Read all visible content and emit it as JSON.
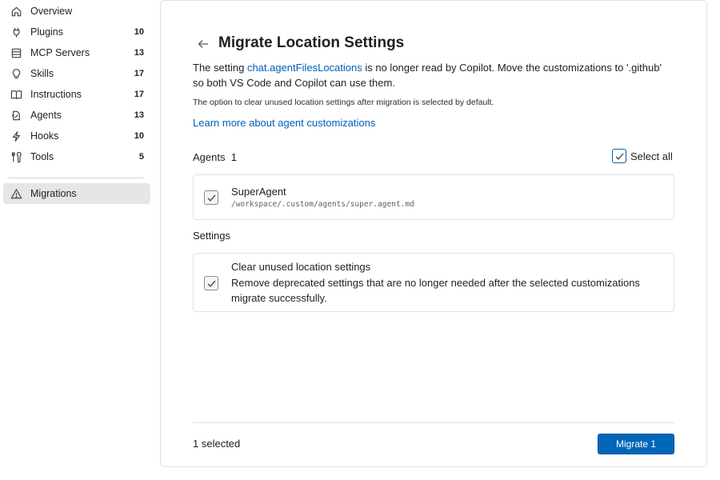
{
  "sidebar": {
    "items": [
      {
        "label": "Overview",
        "count": "",
        "icon": "home-icon"
      },
      {
        "label": "Plugins",
        "count": "10",
        "icon": "plug-icon"
      },
      {
        "label": "MCP Servers",
        "count": "13",
        "icon": "server-icon"
      },
      {
        "label": "Skills",
        "count": "17",
        "icon": "lightbulb-icon"
      },
      {
        "label": "Instructions",
        "count": "17",
        "icon": "book-icon"
      },
      {
        "label": "Agents",
        "count": "13",
        "icon": "agent-icon"
      },
      {
        "label": "Hooks",
        "count": "10",
        "icon": "bolt-icon"
      },
      {
        "label": "Tools",
        "count": "5",
        "icon": "tools-icon"
      }
    ],
    "active_item": {
      "label": "Migrations",
      "icon": "warning-icon"
    }
  },
  "main": {
    "title": "Migrate Location Settings",
    "desc_prefix": "The setting ",
    "desc_link": "chat.agentFilesLocations",
    "desc_suffix": " is no longer read by Copilot. Move the customizations to '.github' so both VS Code and Copilot can use them.",
    "note": "The option to clear unused location settings after migration is selected by default.",
    "learn_more": "Learn more about agent customizations",
    "agents_label": "Agents",
    "agents_count": "1",
    "select_all": "Select all",
    "agent_item": {
      "name": "SuperAgent",
      "path": "/workspace/.custom/agents/super.agent.md",
      "checked": true
    },
    "settings_label": "Settings",
    "settings_item": {
      "title": "Clear unused location settings",
      "description": "Remove deprecated settings that are no longer needed after the selected customizations migrate successfully.",
      "checked": true
    },
    "selected_text": "1 selected",
    "migrate_button": "Migrate 1"
  },
  "colors": {
    "accent": "#005fb8",
    "button": "#0066b8",
    "active_nav": "#e6e6e6"
  }
}
